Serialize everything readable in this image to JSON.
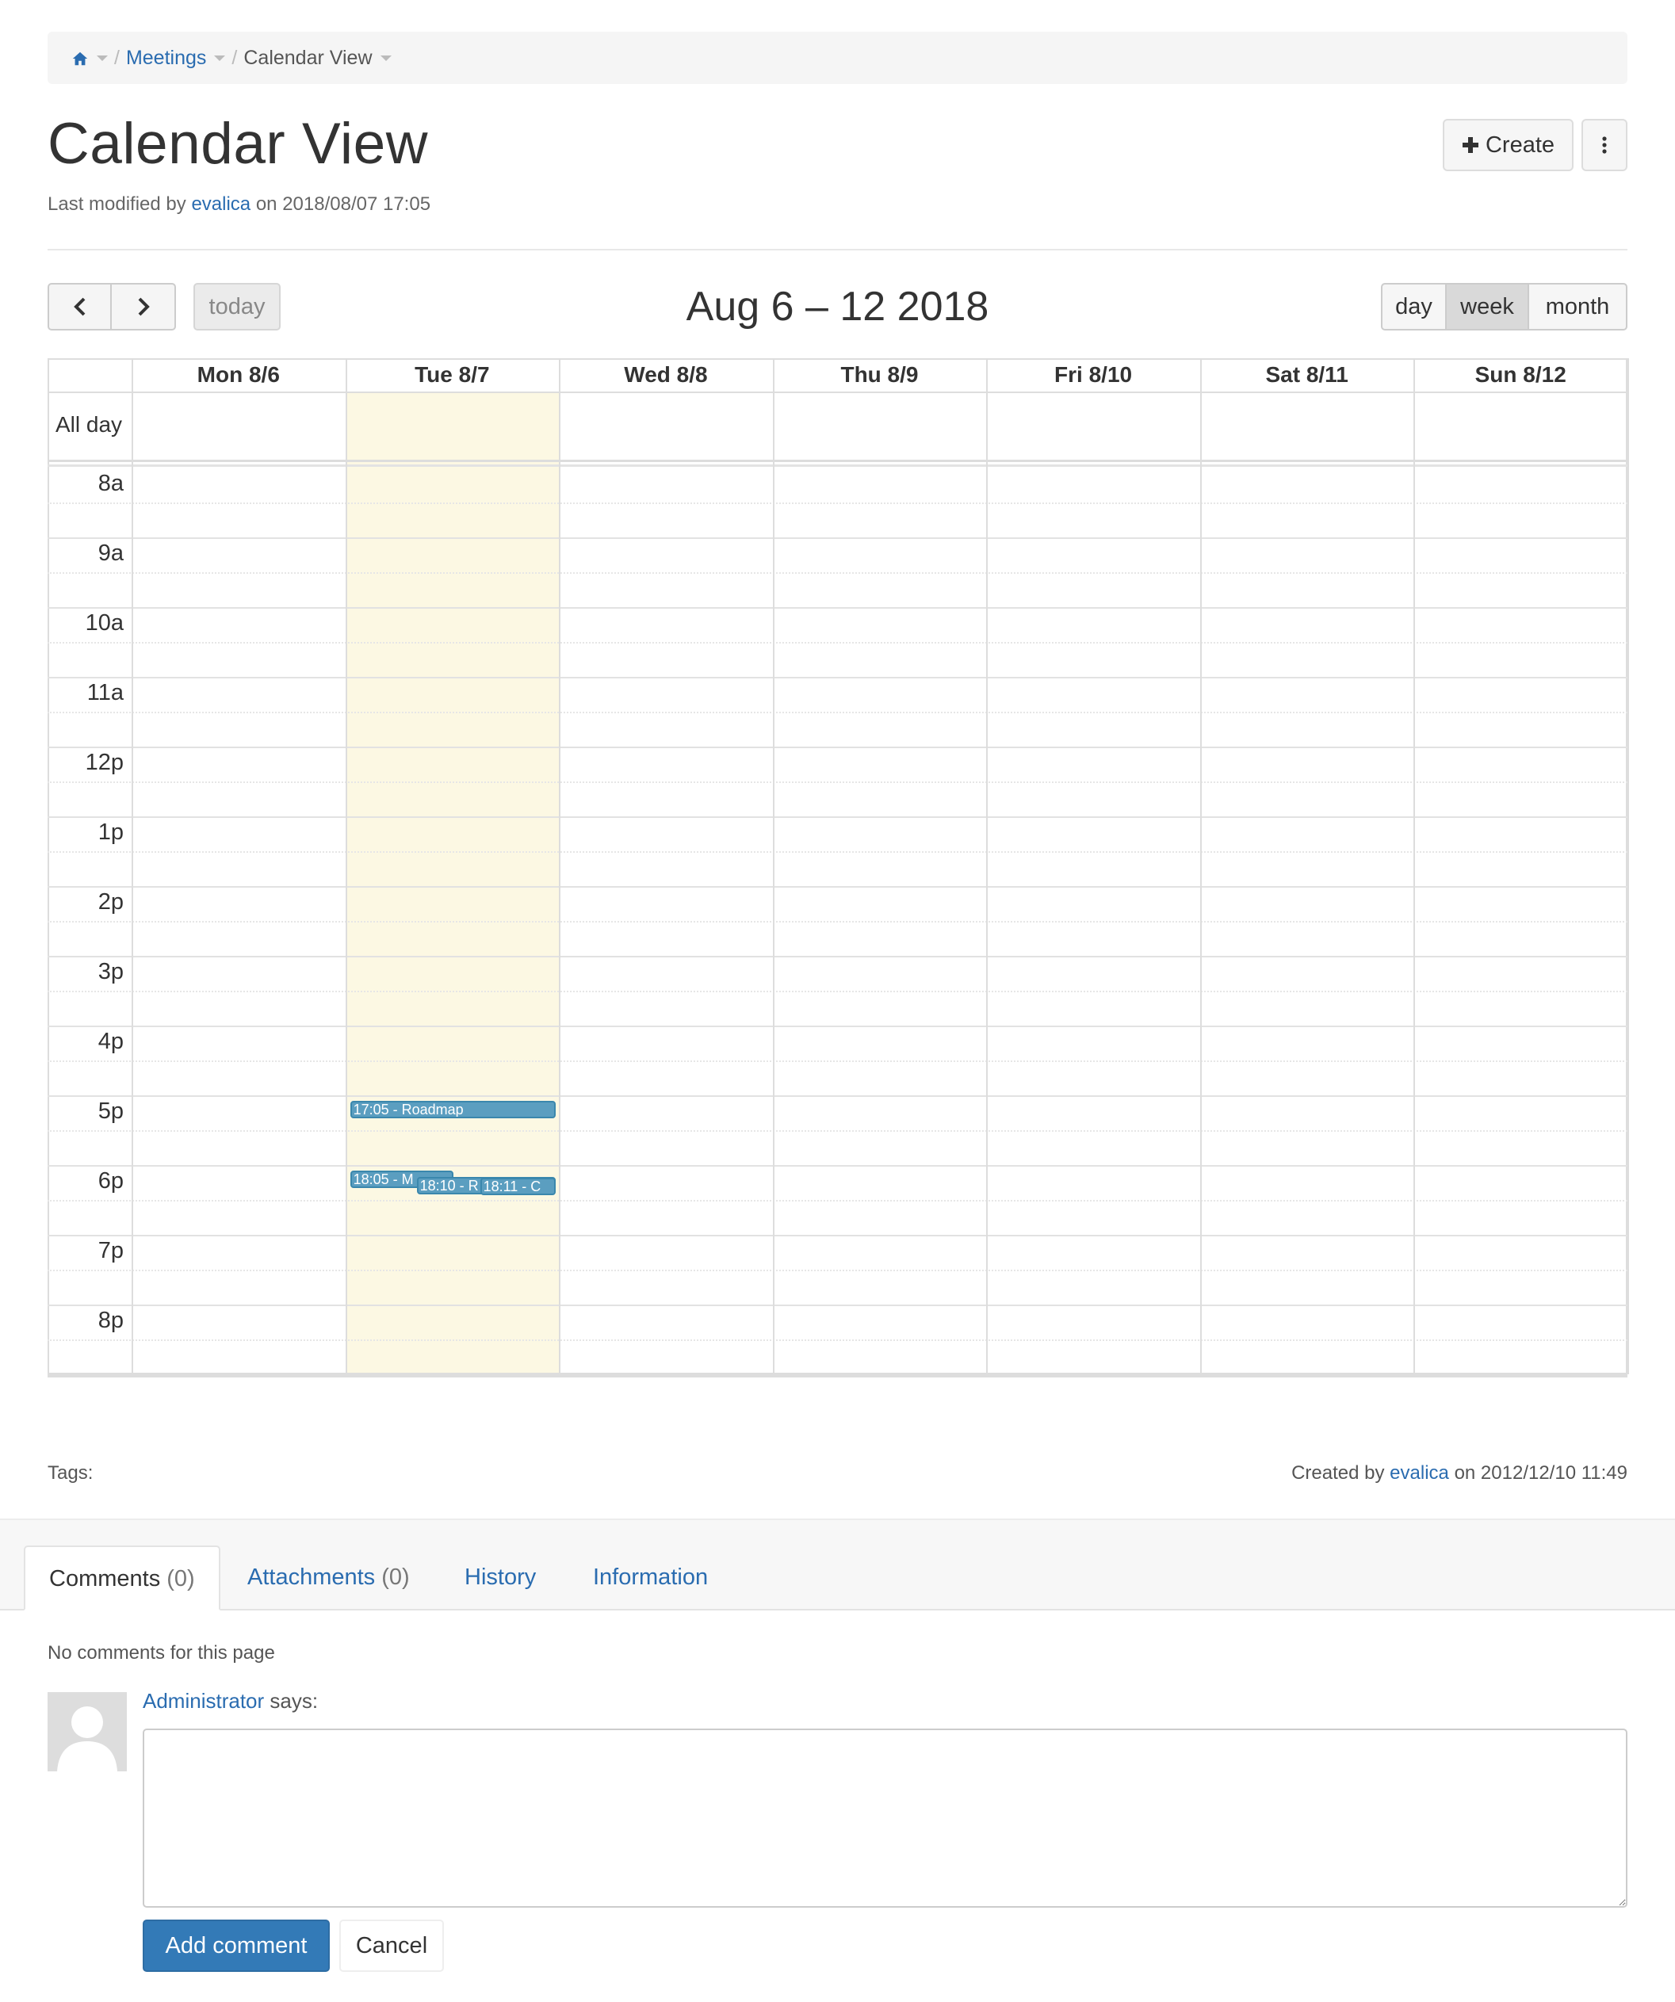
{
  "breadcrumb": {
    "home_icon": "home-icon",
    "items": [
      {
        "label": "Meetings",
        "link": true
      },
      {
        "label": "Calendar View",
        "link": false
      }
    ]
  },
  "page": {
    "title": "Calendar View",
    "last_modified_prefix": "Last modified by",
    "last_modified_user": "evalica",
    "last_modified_on": "on 2018/08/07 17:05"
  },
  "actions": {
    "create_label": "Create",
    "create_icon": "plus-icon",
    "more_icon": "vertical-dots-icon"
  },
  "calendar": {
    "prev_icon": "chevron-left-icon",
    "next_icon": "chevron-right-icon",
    "today_label": "today",
    "range": "Aug 6 – 12 2018",
    "views": [
      "day",
      "week",
      "month"
    ],
    "active_view": "week",
    "allday_label": "All day",
    "days": [
      "Mon 8/6",
      "Tue 8/7",
      "Wed 8/8",
      "Thu 8/9",
      "Fri 8/10",
      "Sat 8/11",
      "Sun 8/12"
    ],
    "today_index": 1,
    "hours": [
      "8a",
      "9a",
      "10a",
      "11a",
      "12p",
      "1p",
      "2p",
      "3p",
      "4p",
      "5p",
      "6p",
      "7p",
      "8p"
    ],
    "events": [
      {
        "text": "17:05 - Roadmap",
        "day": 1,
        "start": "17:05"
      },
      {
        "text": "18:05 - M",
        "day": 1,
        "start": "18:05"
      },
      {
        "text": "18:10 - R",
        "day": 1,
        "start": "18:10"
      },
      {
        "text": "18:11 - C",
        "day": 1,
        "start": "18:11"
      }
    ]
  },
  "footer_meta": {
    "tags_label": "Tags:",
    "created_prefix": "Created by",
    "created_user": "evalica",
    "created_on": "on 2012/12/10 11:49"
  },
  "tabs": [
    {
      "label": "Comments",
      "count": "(0)",
      "active": true
    },
    {
      "label": "Attachments",
      "count": "(0)",
      "active": false
    },
    {
      "label": "History",
      "count": "",
      "active": false
    },
    {
      "label": "Information",
      "count": "",
      "active": false
    }
  ],
  "comments": {
    "empty_text": "No comments for this page",
    "author": "Administrator",
    "says": "says:",
    "textarea_value": "",
    "add_label": "Add comment",
    "cancel_label": "Cancel"
  },
  "colors": {
    "link": "#2a6cb0",
    "today_highlight": "#fcf8e3",
    "event_bg": "#5b9ec0",
    "primary_button": "#337ab7"
  }
}
